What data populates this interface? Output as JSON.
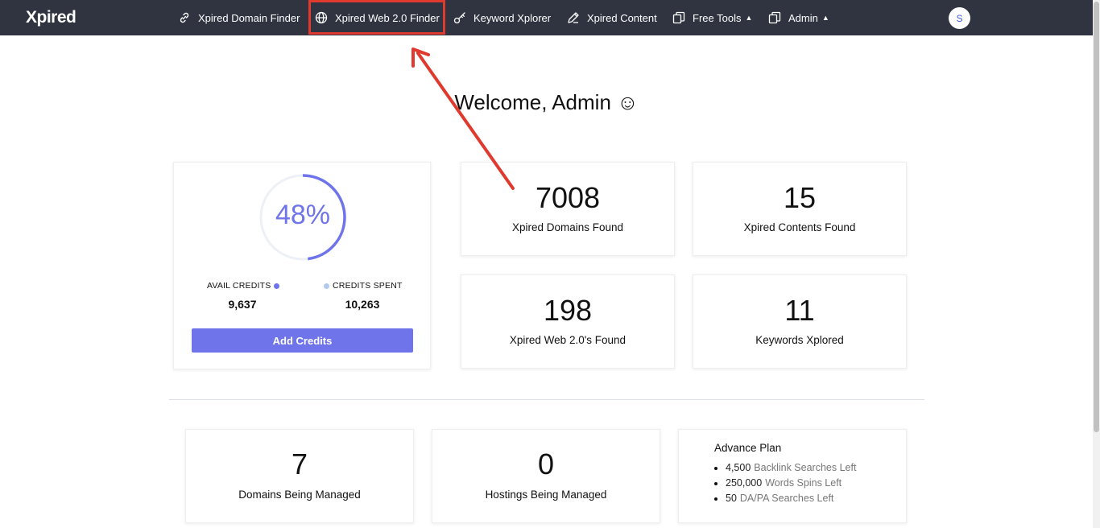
{
  "nav": {
    "logo": "Xpired",
    "items": [
      {
        "label": "Xpired Domain Finder",
        "icon": "link-icon"
      },
      {
        "label": "Xpired Web 2.0 Finder",
        "icon": "globe-icon"
      },
      {
        "label": "Keyword Xplorer",
        "icon": "key-icon"
      },
      {
        "label": "Xpired Content",
        "icon": "pencil-icon"
      },
      {
        "label": "Free Tools",
        "icon": "copy-icon",
        "dropdown": true
      },
      {
        "label": "Admin",
        "icon": "copy-icon",
        "dropdown": true
      }
    ],
    "avatar": "S",
    "highlight_color": "#e03a2f"
  },
  "welcome": "Welcome, Admin ☺",
  "credits": {
    "percent_label": "48%",
    "percent_value": 0.48,
    "avail_label": "AVAIL CREDITS",
    "avail_value": "9,637",
    "spent_label": "CREDITS SPENT",
    "spent_value": "10,263",
    "button": "Add Credits",
    "accent_color": "#6f74ea",
    "spent_color": "#b3c9ee"
  },
  "stats": [
    {
      "value": "7008",
      "label": "Xpired Domains Found"
    },
    {
      "value": "15",
      "label": "Xpired Contents Found"
    },
    {
      "value": "198",
      "label": "Xpired Web 2.0's Found"
    },
    {
      "value": "11",
      "label": "Keywords Xplored"
    }
  ],
  "managed": [
    {
      "value": "7",
      "label": "Domains Being Managed"
    },
    {
      "value": "0",
      "label": "Hostings Being Managed"
    }
  ],
  "plan": {
    "title": "Advance Plan",
    "items": [
      {
        "qty": "4,500",
        "desc": "Backlink Searches Left"
      },
      {
        "qty": "250,000",
        "desc": "Words Spins Left"
      },
      {
        "qty": "50",
        "desc": "DA/PA Searches Left"
      }
    ]
  }
}
